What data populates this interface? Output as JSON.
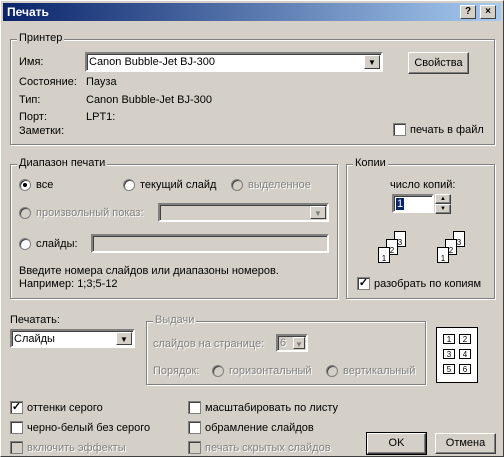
{
  "window": {
    "title": "Печать",
    "help_button": "?",
    "close_button": "×"
  },
  "printer": {
    "group_title": "Принтер",
    "name_label": "Имя:",
    "name_value": "Canon Bubble-Jet BJ-300",
    "properties_button": "Свойства",
    "status_label": "Состояние:",
    "status_value": "Пауза",
    "type_label": "Тип:",
    "type_value": "Canon Bubble-Jet BJ-300",
    "port_label": "Порт:",
    "port_value": "LPT1:",
    "comment_label": "Заметки:",
    "print_to_file_label": "печать в файл",
    "print_to_file_checked": false
  },
  "range": {
    "group_title": "Диапазон печати",
    "all_label": "все",
    "current_label": "текущий слайд",
    "selection_label": "выделенное",
    "custom_show_label": "произвольный показ:",
    "slides_label": "слайды:",
    "slides_value": "",
    "hint_line1": "Введите номера слайдов или диапазоны номеров.",
    "hint_line2": "Например: 1;3;5-12",
    "selected": "all"
  },
  "copies": {
    "group_title": "Копии",
    "count_label": "число копий:",
    "count_value": "1",
    "collate_label": "разобрать по копиям",
    "collate_checked": true
  },
  "print_what": {
    "label": "Печатать:",
    "value": "Слайды"
  },
  "handouts": {
    "group_title": "Выдачи",
    "per_page_label": "слайдов на странице:",
    "per_page_value": "6",
    "order_label": "Порядок:",
    "horizontal_label": "горизонтальный",
    "vertical_label": "вертикальный",
    "preview_numbers": [
      "1",
      "2",
      "3",
      "4",
      "5",
      "6"
    ]
  },
  "options": {
    "grayscale_label": "оттенки серого",
    "grayscale_checked": true,
    "pure_bw_label": "черно-белый без серого",
    "pure_bw_checked": false,
    "animations_label": "включить эффекты",
    "animations_checked": false,
    "scale_to_fit_label": "масштабировать по листу",
    "scale_to_fit_checked": false,
    "frame_slides_label": "обрамление слайдов",
    "frame_slides_checked": false,
    "hidden_slides_label": "печать скрытых слайдов",
    "hidden_slides_checked": false
  },
  "buttons": {
    "ok": "OK",
    "cancel": "Отмена"
  },
  "collate_icons": {
    "left_set": [
      "1",
      "2",
      "3"
    ],
    "right_set": [
      "1",
      "2",
      "3"
    ]
  },
  "colors": {
    "face": "#d4d0c8",
    "title_start": "#0a246a",
    "title_end": "#a6caf0",
    "disabled": "#808080"
  }
}
